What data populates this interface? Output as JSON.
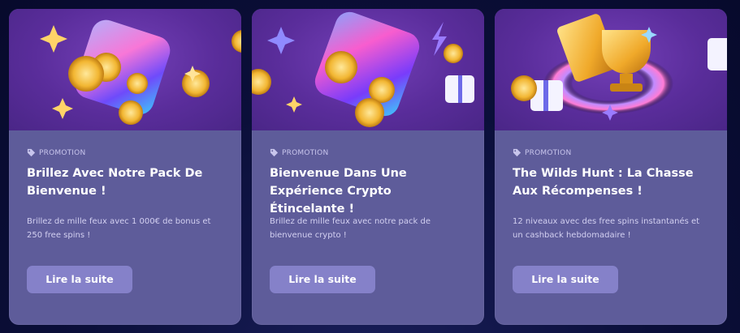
{
  "cards": [
    {
      "tag": "PROMOTION",
      "tag_icon": "tag-icon",
      "title": "Brillez Avec Notre Pack De Bienvenue !",
      "description": "Brillez de mille feux avec 1 000€ de bonus et 250 free spins !",
      "button": "Lire la suite",
      "image": "dice-coins-illustration"
    },
    {
      "tag": "PROMOTION",
      "tag_icon": "tag-icon",
      "title": "Bienvenue Dans Une Expérience Crypto Étincelante !",
      "description": "Brillez de mille feux avec notre pack de bienvenue crypto !",
      "button": "Lire la suite",
      "image": "crypto-dice-illustration"
    },
    {
      "tag": "PROMOTION",
      "tag_icon": "tag-icon",
      "title": "The Wilds Hunt : La Chasse Aux Récompenses !",
      "description": "12 niveaux avec des free spins instantanés et un cashback hebdomadaire !",
      "button": "Lire la suite",
      "image": "trophy-gift-illustration"
    }
  ],
  "colors": {
    "background": "#0b0f3a",
    "card": "#5e5c9a",
    "banner": "#5a2d9b",
    "button": "#8581c9"
  }
}
